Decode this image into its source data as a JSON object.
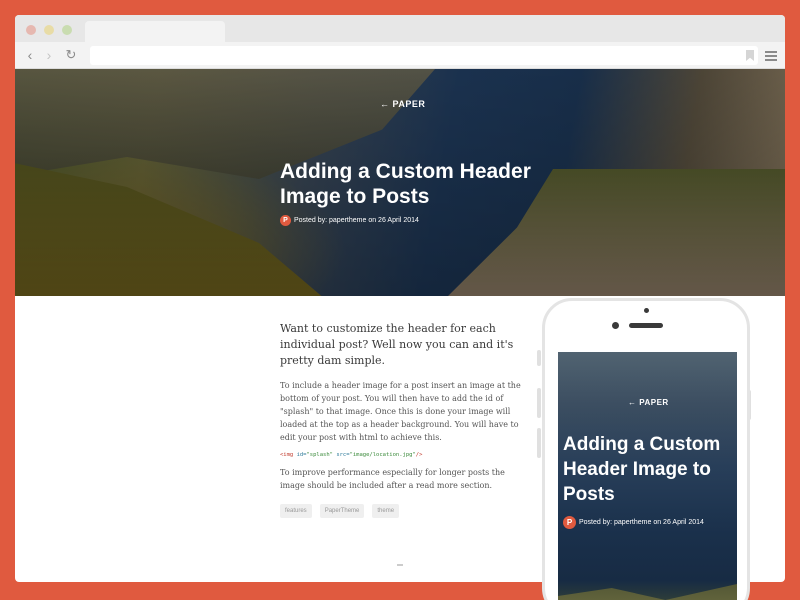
{
  "browser": {
    "back_glyph": "‹",
    "forward_glyph": "›",
    "reload_glyph": "↻"
  },
  "post": {
    "back_link": "← PAPER",
    "title": "Adding a Custom Header Image to Posts",
    "byline": "Posted by: papertheme on 26 April 2014",
    "avatar_letter": "P",
    "lead": "Want to customize the header for each individual post? Well now you can and it's pretty dam simple.",
    "para1": "To include a header image for a post insert an image at the bottom of your post. You will then have to add the id of \"splash\" to that image. Once this is done your image will loaded at the top as a header background. You will have to edit your post with html to achieve this.",
    "code_tag_open": "<img",
    "code_attr1": "id=",
    "code_val1": "\"splash\"",
    "code_attr2": "src=",
    "code_val2": "\"image/location.jpg\"",
    "code_tag_close": "/>",
    "para2": "To improve performance especially for longer posts the image should be included after a read more section.",
    "tags": [
      "features",
      "PaperTheme",
      "theme"
    ]
  },
  "mobile": {
    "back_link": "← PAPER",
    "title": "Adding a Custom Header Image to Posts",
    "byline": "Posted by: papertheme on 26 April 2014",
    "avatar_letter": "P"
  },
  "colors": {
    "background": "#e05a3f",
    "accent": "#e05a3f"
  }
}
